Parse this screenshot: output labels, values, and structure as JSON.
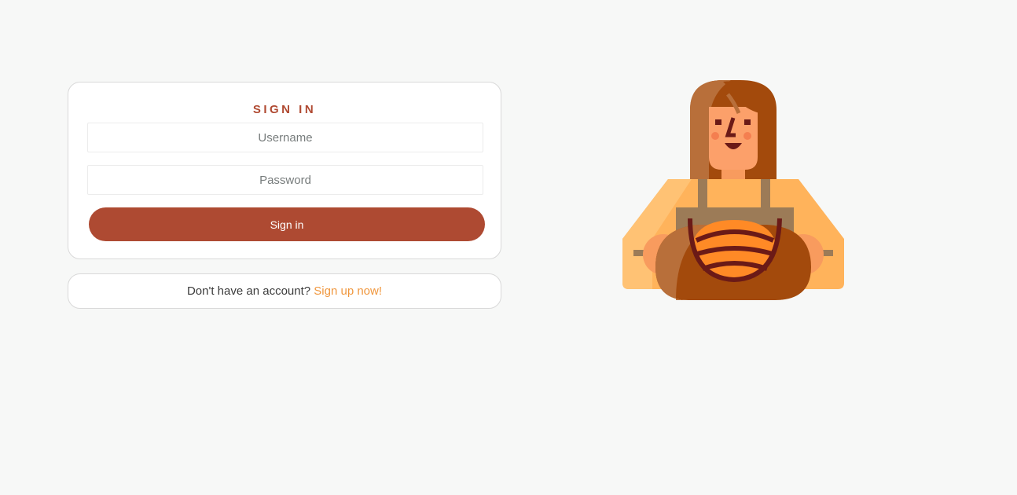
{
  "signin": {
    "title": "SIGN IN",
    "username_placeholder": "Username",
    "password_placeholder": "Password",
    "button_label": "Sign in"
  },
  "signup": {
    "prompt": "Don't have an account?",
    "link_label": "Sign up now!"
  },
  "illustration": {
    "icon": "baker-woman-illustration"
  },
  "colors": {
    "background": "#f7f8f7",
    "accent": "#ae4a32",
    "link": "#f0973e"
  }
}
